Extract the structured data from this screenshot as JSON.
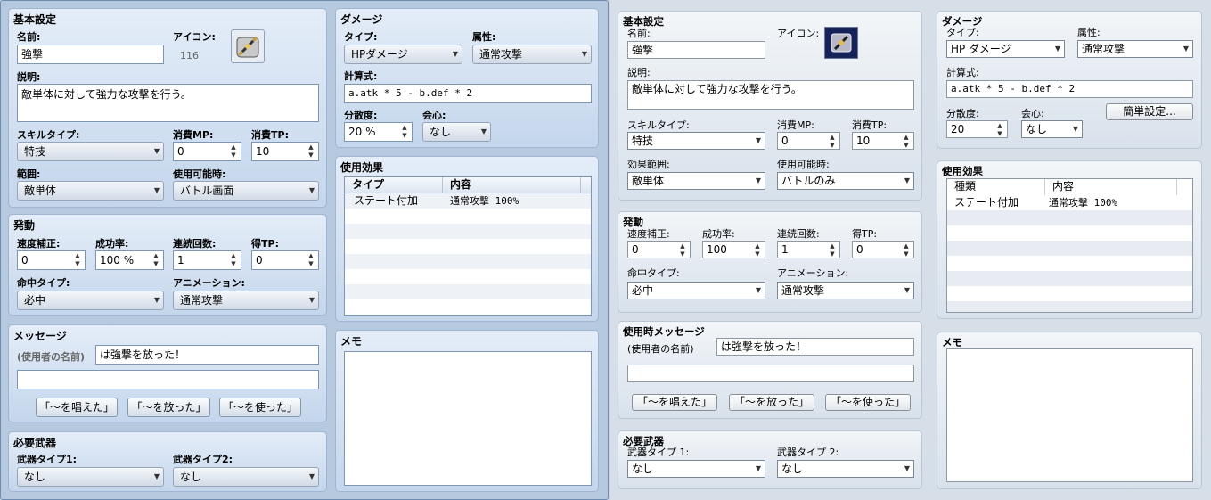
{
  "left": {
    "basic": {
      "title": "基本設定",
      "name_label": "名前:",
      "name_value": "強撃",
      "icon_label": "アイコン:",
      "icon_index": "116",
      "icon_name": "sword-skill-icon",
      "desc_label": "説明:",
      "desc_value": "敵単体に対して強力な攻撃を行う。",
      "skill_type_label": "スキルタイプ:",
      "skill_type_value": "特技",
      "mp_label": "消費MP:",
      "mp_value": "0",
      "tp_label": "消費TP:",
      "tp_value": "10",
      "scope_label": "範囲:",
      "scope_value": "敵単体",
      "occasion_label": "使用可能時:",
      "occasion_value": "バトル画面"
    },
    "invocation": {
      "title": "発動",
      "speed_label": "速度補正:",
      "speed_value": "0",
      "success_label": "成功率:",
      "success_value": "100 %",
      "repeat_label": "連続回数:",
      "repeat_value": "1",
      "tp_gain_label": "得TP:",
      "tp_gain_value": "0",
      "hit_type_label": "命中タイプ:",
      "hit_type_value": "必中",
      "anim_label": "アニメーション:",
      "anim_value": "通常攻撃"
    },
    "message": {
      "title": "メッセージ",
      "user_label": "(使用者の名前)",
      "line1": "は強撃を放った！",
      "line2": "",
      "btn1": "「〜を唱えた」",
      "btn2": "「〜を放った」",
      "btn3": "「〜を使った」"
    },
    "weapons": {
      "title": "必要武器",
      "w1_label": "武器タイプ1:",
      "w1_value": "なし",
      "w2_label": "武器タイプ2:",
      "w2_value": "なし"
    },
    "damage": {
      "title": "ダメージ",
      "type_label": "タイプ:",
      "type_value": "HPダメージ",
      "element_label": "属性:",
      "element_value": "通常攻撃",
      "formula_label": "計算式:",
      "formula_value": "a.atk * 5 - b.def * 2",
      "variance_label": "分散度:",
      "variance_value": "20 %",
      "critical_label": "会心:",
      "critical_value": "なし"
    },
    "effects": {
      "title": "使用効果",
      "col1": "タイプ",
      "col2": "内容",
      "rows": [
        {
          "type": "ステート付加",
          "content": "通常攻撃 100%"
        }
      ]
    },
    "memo": {
      "title": "メモ"
    }
  },
  "right": {
    "basic": {
      "title": "基本設定",
      "name_label": "名前:",
      "name_value": "強撃",
      "icon_label": "アイコン:",
      "icon_name": "sword-skill-icon",
      "desc_label": "説明:",
      "desc_value": "敵単体に対して強力な攻撃を行う。",
      "skill_type_label": "スキルタイプ:",
      "skill_type_value": "特技",
      "mp_label": "消費MP:",
      "mp_value": "0",
      "tp_label": "消費TP:",
      "tp_value": "10",
      "scope_label": "効果範囲:",
      "scope_value": "敵単体",
      "occasion_label": "使用可能時:",
      "occasion_value": "バトルのみ"
    },
    "invocation": {
      "title": "発動",
      "speed_label": "速度補正:",
      "speed_value": "0",
      "success_label": "成功率:",
      "success_value": "100",
      "repeat_label": "連続回数:",
      "repeat_value": "1",
      "tp_gain_label": "得TP:",
      "tp_gain_value": "0",
      "hit_type_label": "命中タイプ:",
      "hit_type_value": "必中",
      "anim_label": "アニメーション:",
      "anim_value": "通常攻撃"
    },
    "message": {
      "title": "使用時メッセージ",
      "user_label": "(使用者の名前)",
      "line1": "は強撃を放った！",
      "line2": "",
      "btn1": "「〜を唱えた」",
      "btn2": "「〜を放った」",
      "btn3": "「〜を使った」"
    },
    "weapons": {
      "title": "必要武器",
      "w1_label": "武器タイプ 1:",
      "w1_value": "なし",
      "w2_label": "武器タイプ 2:",
      "w2_value": "なし"
    },
    "damage": {
      "title": "ダメージ",
      "type_label": "タイプ:",
      "type_value": "HP ダメージ",
      "element_label": "属性:",
      "element_value": "通常攻撃",
      "formula_label": "計算式:",
      "formula_value": "a.atk * 5 - b.def * 2",
      "variance_label": "分散度:",
      "variance_value": "20",
      "critical_label": "会心:",
      "critical_value": "なし",
      "simple_btn": "簡単設定..."
    },
    "effects": {
      "title": "使用効果",
      "col1": "種類",
      "col2": "内容",
      "rows": [
        {
          "type": "ステート付加",
          "content": "通常攻撃 100%"
        }
      ]
    },
    "memo": {
      "title": "メモ"
    }
  }
}
